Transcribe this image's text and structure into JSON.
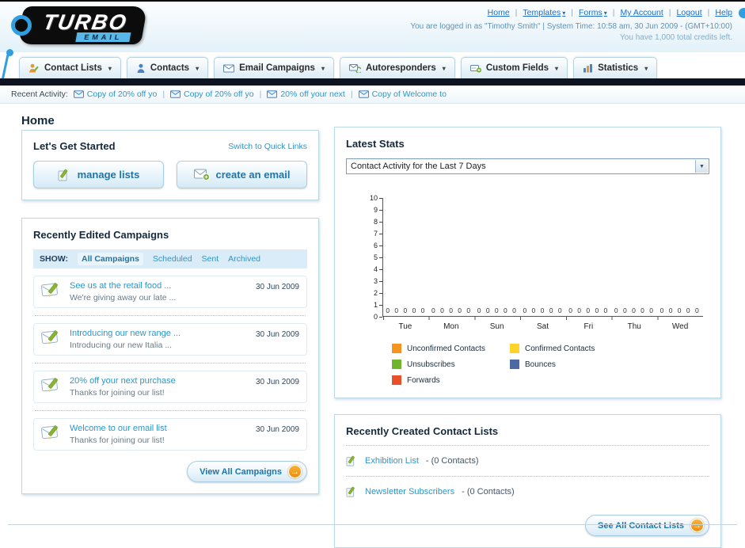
{
  "icons": {
    "caret_down": "▾",
    "select_arrow": "▼",
    "separator": "|",
    "arrow_right": "→"
  },
  "header": {
    "logo_title": "TURBO",
    "logo_subtitle": "EMAIL",
    "nav": [
      {
        "label": "Home"
      },
      {
        "label": "Templates"
      },
      {
        "label": "Forms"
      },
      {
        "label": "My Account"
      },
      {
        "label": "Logout"
      },
      {
        "label": "Help"
      }
    ],
    "login_info": "You are logged in as \"Timothy Smith\" | System Time: 10:58 am, 30 Jun 2009 - (GMT+10:00)",
    "credits_info": "You have 1,000 total credits left."
  },
  "main_tabs": [
    {
      "label": "Contact Lists"
    },
    {
      "label": "Contacts"
    },
    {
      "label": "Email Campaigns"
    },
    {
      "label": "Autoresponders"
    },
    {
      "label": "Custom Fields"
    },
    {
      "label": "Statistics"
    }
  ],
  "recent_activity": {
    "label": "Recent Activity:",
    "items": [
      {
        "label": "Copy of 20% off yo"
      },
      {
        "label": "Copy of 20% off yo"
      },
      {
        "label": "20% off your next"
      },
      {
        "label": "Copy of Welcome to"
      }
    ]
  },
  "page_title": "Home",
  "get_started": {
    "title": "Let's Get Started",
    "switch_link": "Switch to Quick Links",
    "manage_lists_label": "manage lists",
    "create_email_label": "create an email"
  },
  "campaigns": {
    "title": "Recently Edited Campaigns",
    "show_label": "SHOW:",
    "filters": [
      {
        "label": "All Campaigns"
      },
      {
        "label": "Scheduled"
      },
      {
        "label": "Sent"
      },
      {
        "label": "Archived"
      }
    ],
    "items": [
      {
        "title": "See us at the retail food ...",
        "subtitle": "We're giving away our late ...",
        "date": "30 Jun 2009"
      },
      {
        "title": "Introducing our new range ...",
        "subtitle": "Introducing our new Italia ...",
        "date": "30 Jun 2009"
      },
      {
        "title": "20% off your next purchase",
        "subtitle": "Thanks for joining our list!",
        "date": "30 Jun 2009"
      },
      {
        "title": "Welcome to our email list",
        "subtitle": "Thanks for joining our list!",
        "date": "30 Jun 2009"
      }
    ],
    "view_all_label": "View All Campaigns"
  },
  "latest_stats": {
    "title": "Latest Stats",
    "period_selector": "Contact Activity for the Last 7 Days",
    "chart_data": {
      "type": "bar",
      "title": "Contact Activity for the Last 7 Days",
      "categories": [
        "Tue",
        "Mon",
        "Sun",
        "Sat",
        "Fri",
        "Thu",
        "Wed"
      ],
      "series": [
        {
          "name": "Unconfirmed Contacts",
          "color": "#f79421",
          "values": [
            0,
            0,
            0,
            0,
            0,
            0,
            0
          ]
        },
        {
          "name": "Confirmed Contacts",
          "color": "#ffd42a",
          "values": [
            0,
            0,
            0,
            0,
            0,
            0,
            0
          ]
        },
        {
          "name": "Unsubscribes",
          "color": "#6eb42c",
          "values": [
            0,
            0,
            0,
            0,
            0,
            0,
            0
          ]
        },
        {
          "name": "Bounces",
          "color": "#4a69a5",
          "values": [
            0,
            0,
            0,
            0,
            0,
            0,
            0
          ]
        },
        {
          "name": "Forwards",
          "color": "#e8502a",
          "values": [
            0,
            0,
            0,
            0,
            0,
            0,
            0
          ]
        }
      ],
      "ylim": [
        0,
        10
      ],
      "ytick_step": 1,
      "grid": false,
      "legend_position": "bottom"
    }
  },
  "contact_lists": {
    "title": "Recently Created Contact Lists",
    "items": [
      {
        "name": "Exhibition List",
        "suffix": "- (0 Contacts)"
      },
      {
        "name": "Newsletter Subscribers",
        "suffix": "- (0 Contacts)"
      }
    ],
    "see_all_label": "See All Contact Lists"
  }
}
